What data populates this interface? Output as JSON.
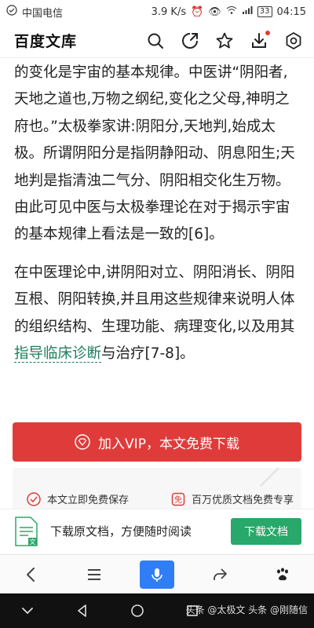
{
  "status_bar": {
    "carrier": "中国电信",
    "speed": "3.9 K/s",
    "battery": "33",
    "time": "04:15"
  },
  "header": {
    "title": "百度文库",
    "icons": [
      "search-icon",
      "share-icon",
      "star-icon",
      "download-icon",
      "settings-icon"
    ]
  },
  "article": {
    "paragraph1": "的变化是宇宙的基本规律。中医讲“阴阳者,天地之道也,万物之纲纪,变化之父母,神明之府也。”太极拳家讲:阴阳分,天地判,始成太极。所谓阴阳分是指阴静阳动、阴息阳生;天地判是指清浊二气分、阴阳相交化生万物。由此可见中医与太极拳理论在对于揭示宇宙的基本规律上看法是一致的[6]。",
    "paragraph2_pre": "在中医理论中,讲阴阳对立、阴阳消长、阴阳互根、阴阳转换,并且用这些规律来说明人体的组织结构、生理功能、病理变化,以及用其",
    "paragraph2_link": "指导临床诊断",
    "paragraph2_post": "与治疗[7-8]。"
  },
  "vip": {
    "label": "加入VIP，本文免费下载",
    "color": "#e03b3b"
  },
  "benefits": {
    "item1": "本文立即免费保存",
    "item2": "百万优质文档免费专享"
  },
  "download_banner": {
    "text": "下载原文档，方便随时阅读",
    "button": "下载文档",
    "button_color": "#28a86a"
  },
  "browser_nav": [
    "back-icon",
    "menu-icon",
    "mic-icon",
    "share-icon",
    "paw-icon"
  ],
  "watermark": "头条 @太极文 头条 @刚随信"
}
